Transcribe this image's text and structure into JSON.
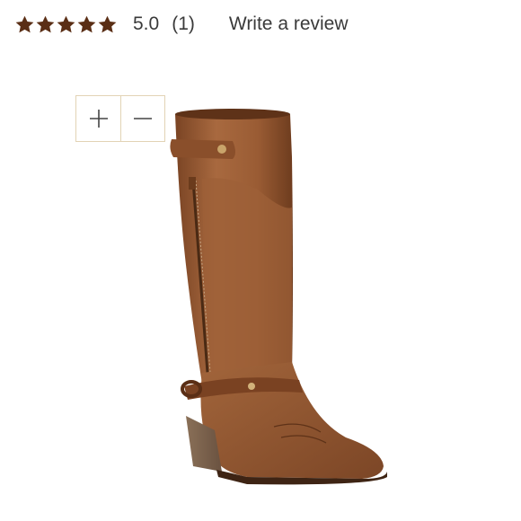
{
  "rating": {
    "stars_filled": 5,
    "stars_total": 5,
    "value": "5.0",
    "count": "(1)",
    "star_color": "#5a2e15"
  },
  "actions": {
    "write_review_label": "Write a review"
  },
  "zoom": {
    "zoom_in_icon": "plus-icon",
    "zoom_out_icon": "minus-icon"
  },
  "product": {
    "image_subject": "brown leather western boot with side zipper and harness strap",
    "leather_color": "#9a5c34"
  }
}
